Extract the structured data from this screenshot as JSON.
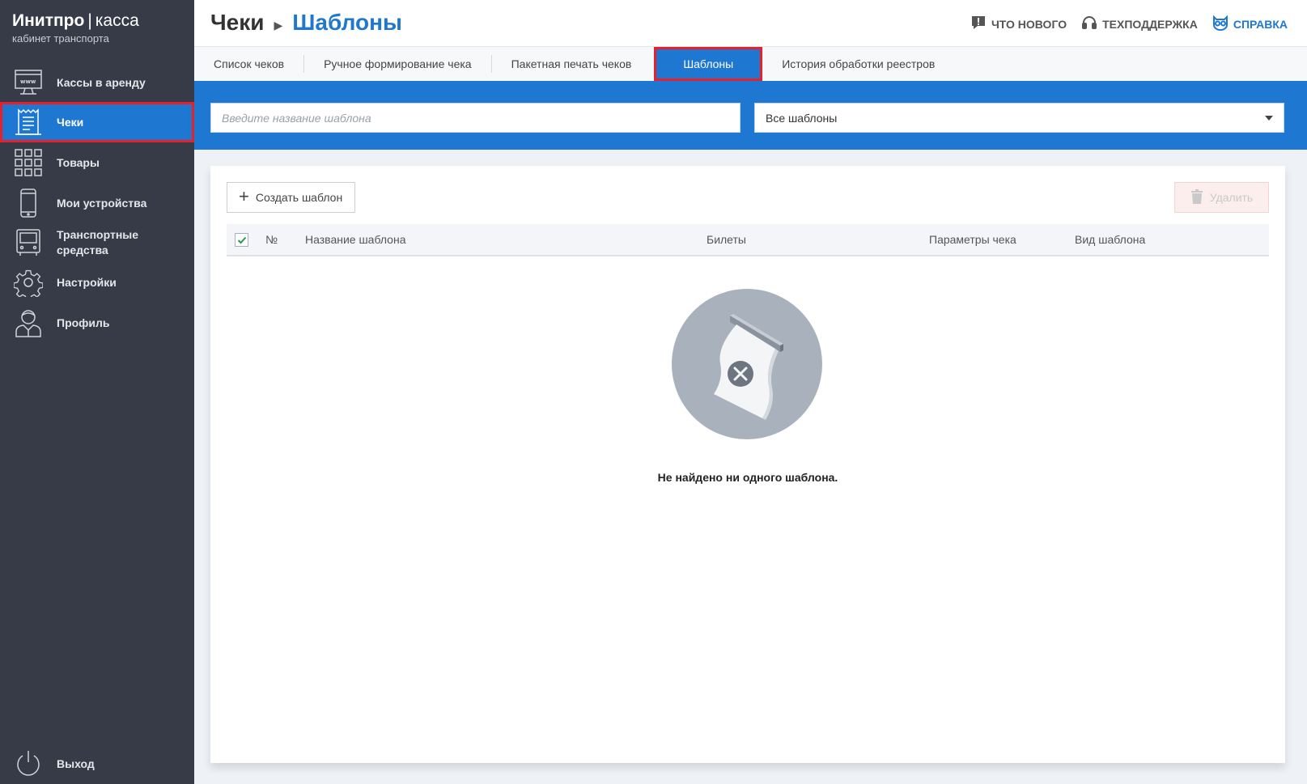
{
  "brand": {
    "name": "Инитпро",
    "product": "касса",
    "subtitle": "кабинет транспорта"
  },
  "sidebar": {
    "items": [
      {
        "label": "Кассы в аренду",
        "icon": "monitor-www-icon"
      },
      {
        "label": "Чеки",
        "icon": "receipt-icon",
        "active": true
      },
      {
        "label": "Товары",
        "icon": "grid-icon"
      },
      {
        "label": "Мои устройства",
        "icon": "phone-icon"
      },
      {
        "label": "Транспортные средства",
        "icon": "bus-icon"
      },
      {
        "label": "Настройки",
        "icon": "gear-icon"
      },
      {
        "label": "Профиль",
        "icon": "user-icon"
      }
    ],
    "logout": {
      "label": "Выход",
      "icon": "power-icon"
    }
  },
  "header": {
    "breadcrumb_root": "Чеки",
    "breadcrumb_current": "Шаблоны",
    "links": {
      "whats_new": "ЧТО НОВОГО",
      "support": "ТЕХПОДДЕРЖКА",
      "help": "СПРАВКА"
    }
  },
  "tabs": [
    {
      "label": "Список чеков"
    },
    {
      "label": "Ручное формирование чека"
    },
    {
      "label": "Пакетная печать чеков"
    },
    {
      "label": "Шаблоны",
      "active": true
    },
    {
      "label": "История обработки реестров"
    }
  ],
  "filters": {
    "search_placeholder": "Введите название шаблона",
    "search_value": "",
    "select_value": "Все шаблоны"
  },
  "toolbar": {
    "create_label": "Создать шаблон",
    "delete_label": "Удалить"
  },
  "table": {
    "columns": [
      "№",
      "Название шаблона",
      "Билеты",
      "Параметры чека",
      "Вид шаблона"
    ],
    "rows": []
  },
  "empty_state": {
    "message": "Не найдено ни одного шаблона."
  },
  "colors": {
    "accent": "#1e78d2",
    "sidebar": "#363b47",
    "highlight": "#e8202a"
  }
}
